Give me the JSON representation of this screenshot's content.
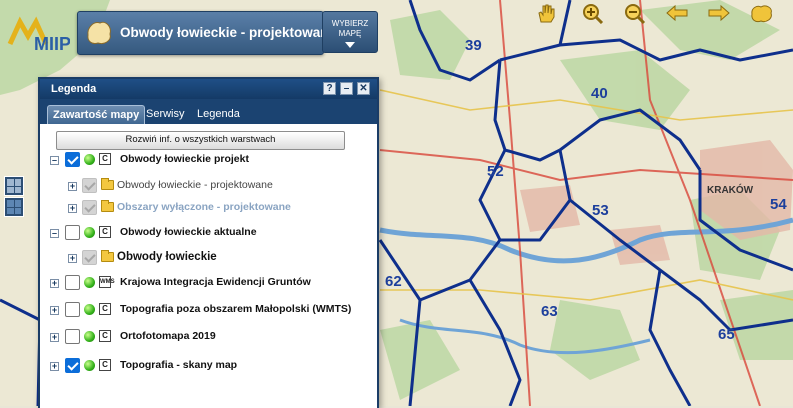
{
  "map": {
    "district_numbers": [
      "39",
      "40",
      "52",
      "53",
      "54",
      "62",
      "63",
      "65"
    ],
    "city_label": "KRAKÓW"
  },
  "header": {
    "logo_text": "MIIP",
    "title": "Obwody łowieckie - projektowane",
    "choose_map_line1": "WYBIERZ",
    "choose_map_line2": "MAPĘ"
  },
  "toolbar": {
    "tools": [
      "pan-hand-icon",
      "zoom-in-icon",
      "zoom-out-icon",
      "back-arrow-icon",
      "forward-arrow-icon",
      "region-map-icon"
    ]
  },
  "legend_panel": {
    "title": "Legenda",
    "tabs": [
      "Zawartość mapy",
      "Serwisy",
      "Legenda"
    ],
    "active_tab": "Zawartość mapy",
    "expand_all_label": "Rozwiń inf. o wszystkich warstwach",
    "layers": [
      {
        "label": "Obwody łowieckie projekt",
        "checked": true,
        "level": 0
      },
      {
        "label": "Obwody łowieckie - projektowane",
        "checked": true,
        "level": 1
      },
      {
        "label": "Obszary wyłączone - projektowane",
        "checked": true,
        "level": 1
      },
      {
        "label": "Obwody łowieckie aktualne",
        "checked": false,
        "level": 0
      },
      {
        "label": "Obwody łowieckie",
        "checked": false,
        "level": 1
      },
      {
        "label": "Krajowa Integracja Ewidencji Gruntów",
        "checked": false,
        "level": 0
      },
      {
        "label": "Topografia poza obszarem Małopolski (WMTS)",
        "checked": false,
        "level": 0
      },
      {
        "label": "Ortofotomapa 2019",
        "checked": false,
        "level": 0
      },
      {
        "label": "Topografia - skany map",
        "checked": true,
        "level": 0
      }
    ]
  },
  "colors": {
    "boundary": "#0e2f8c",
    "panel_header": "#1b4371",
    "title_box": "#3f6791"
  }
}
